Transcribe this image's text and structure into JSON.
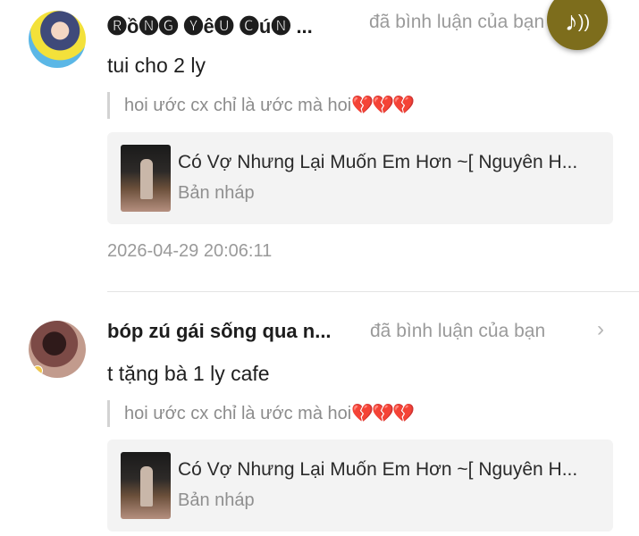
{
  "notifications": [
    {
      "user_name": "🅡ồ🅝🅖 🅨ê🅤 🅒ú🅝 ...",
      "action": "đã bình luận của bạn",
      "comment": "tui cho 2 ly",
      "quoted_comment": "hoi ước cx chỉ là ước mà hoi",
      "quoted_emoji": "💔💔💔",
      "song": {
        "title": "Có Vợ Nhưng Lại Muốn Em Hơn ~[ Nguyên H...",
        "status": "Bản nháp"
      },
      "timestamp": "2026-04-29 20:06:11"
    },
    {
      "user_name": "bóp zú gái sống qua n...",
      "action": "đã bình luận của bạn",
      "comment": "t tặng bà 1 ly cafe",
      "quoted_comment": "hoi ước cx chỉ là ước mà hoi",
      "quoted_emoji": "💔💔💔",
      "song": {
        "title": "Có Vợ Nhưng Lại Muốn Em Hơn ~[ Nguyên H...",
        "status": "Bản nháp"
      }
    }
  ],
  "icons": {
    "chevron": "chevron-right-icon",
    "music": "music-note-sound-icon"
  },
  "colors": {
    "music_button": "#7d6d1c",
    "heart": "#e63b7a"
  }
}
